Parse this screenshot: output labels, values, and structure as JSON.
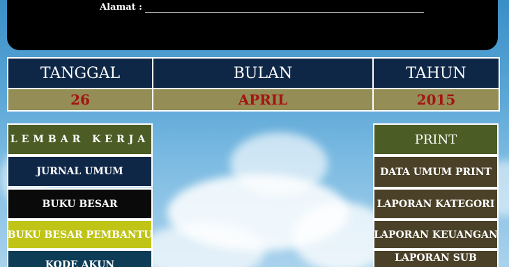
{
  "header": {
    "alamat_label": "Alamat :"
  },
  "date": {
    "headers": [
      "TANGGAL",
      "BULAN",
      "TAHUN"
    ],
    "values": [
      "26",
      "APRIL",
      "2015"
    ]
  },
  "left_menu": {
    "title": "LEMBAR KERJA",
    "items": [
      "JURNAL UMUM",
      "BUKU BESAR",
      "BUKU BESAR PEMBANTU",
      "KODE AKUN"
    ]
  },
  "right_menu": {
    "title": "PRINT",
    "items": [
      "DATA UMUM PRINT",
      "LAPORAN KATEGORI",
      "LAPORAN KEUANGAN",
      "LAPORAN SUB"
    ]
  },
  "colors": {
    "header_bg": "#000000",
    "date_header_bg": "#0f2747",
    "date_value_bg": "#948d55",
    "date_value_text": "#a31414",
    "lembar_bg": "#4b5c25",
    "pembantu_bg": "#bfc417",
    "print_item_bg": "#4a4128"
  }
}
